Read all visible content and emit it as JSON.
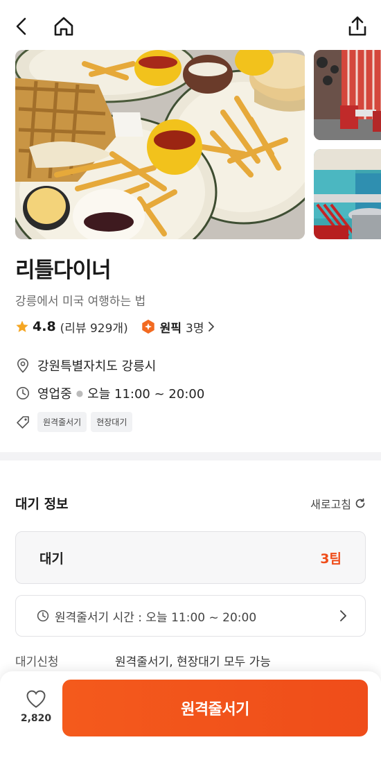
{
  "header": {
    "back_icon": "chevron-left-icon",
    "home_icon": "home-icon",
    "share_icon": "share-icon"
  },
  "place": {
    "name": "리틀다이너",
    "tagline": "강릉에서 미국 여행하는 법",
    "rating": "4.8",
    "review_text": "(리뷰 929개)",
    "pick_label": "원픽",
    "pick_count": "3명",
    "address": "강원특별자치도 강릉시",
    "status": "영업중",
    "hours": "오늘 11:00 ~ 20:00",
    "tags": [
      "원격줄서기",
      "현장대기"
    ]
  },
  "waiting": {
    "section_title": "대기 정보",
    "refresh_label": "새로고침",
    "wait_label": "대기",
    "wait_count": "3팀",
    "remote_time": "원격줄서기 시간 : 오늘 11:00 ~ 20:00",
    "apply_label": "대기신청",
    "apply_value": "원격줄서기, 현장대기 모두 가능"
  },
  "footer": {
    "like_count": "2,820",
    "cta_label": "원격줄서기"
  },
  "colors": {
    "accent": "#ef4d1a",
    "star": "#f5a623",
    "badge": "#f26a21"
  }
}
